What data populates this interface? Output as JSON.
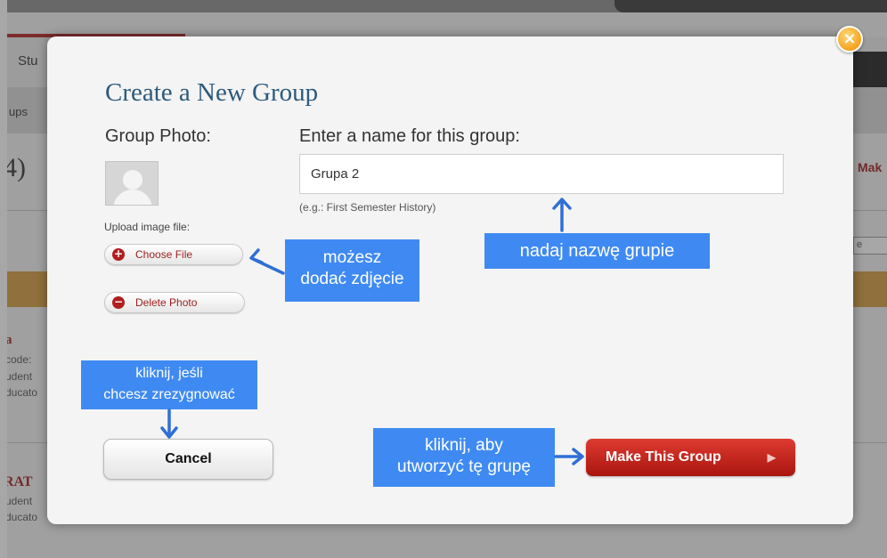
{
  "background": {
    "nav_tab_fragment": "Stu",
    "subnav_fragment": "ups",
    "count_fragment": "4)",
    "make_fragment": "Mak",
    "input_fragment": "e",
    "group1_title_fragment": "a",
    "group1_line1": "code:",
    "group1_line2": "udent",
    "group1_line3": "ducato",
    "group2_title_fragment": "RAT",
    "group2_line1": "udent",
    "group2_line2": "ducato"
  },
  "modal": {
    "close_label": "×",
    "title": "Create a New Group",
    "photo_label": "Group Photo:",
    "upload_label": "Upload image file:",
    "choose_file_label": "Choose File",
    "choose_file_icon": "+",
    "delete_photo_label": "Delete Photo",
    "delete_photo_icon": "−",
    "name_label": "Enter a name for this group:",
    "name_value": "Grupa 2",
    "name_example": "(e.g.: First Semester History)",
    "cancel_label": "Cancel",
    "make_label": "Make This Group",
    "make_arrow": "▶"
  },
  "callouts": {
    "photo_line1": "możesz",
    "photo_line2": "dodać zdjęcie",
    "name": "nadaj nazwę grupie",
    "cancel_line1": "kliknij, jeśli",
    "cancel_line2": "chcesz zrezygnować",
    "make_line1": "kliknij, aby",
    "make_line2": "utworzyć tę grupę"
  },
  "colors": {
    "title_blue": "#2d5a7c",
    "callout_blue": "#3f8af2",
    "make_button_red": "#c4261d",
    "close_orange": "#f5a623"
  }
}
